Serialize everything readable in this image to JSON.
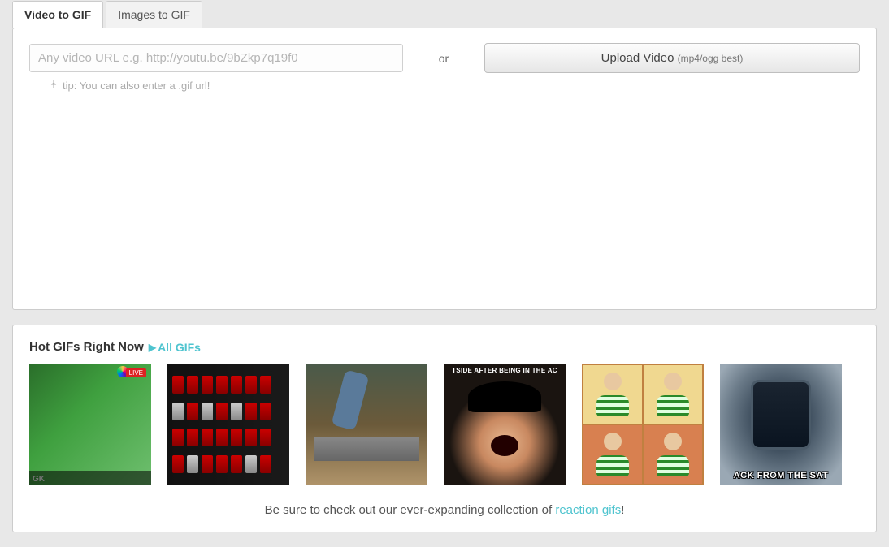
{
  "tabs": {
    "video": "Video to GIF",
    "images": "Images to GIF"
  },
  "input": {
    "placeholder": "Any video URL e.g. http://youtu.be/9bZkp7q19f0",
    "or": "or",
    "upload_label": "Upload Video",
    "upload_hint": "(mp4/ogg best)",
    "tip": "tip: You can also enter a .gif url!"
  },
  "hot": {
    "title": "Hot GIFs Right Now",
    "all_link": "All GIFs",
    "thumbs": [
      {
        "caption_bottom": "GK",
        "badge_live": "LIVE"
      },
      {},
      {},
      {
        "caption_top": "TSIDE AFTER BEING IN THE AC"
      },
      {},
      {
        "caption_bottom": "ACK FROM THE SAT"
      }
    ]
  },
  "footer": {
    "prefix": "Be sure to check out our ever-expanding collection of ",
    "link": "reaction gifs",
    "suffix": "!"
  }
}
